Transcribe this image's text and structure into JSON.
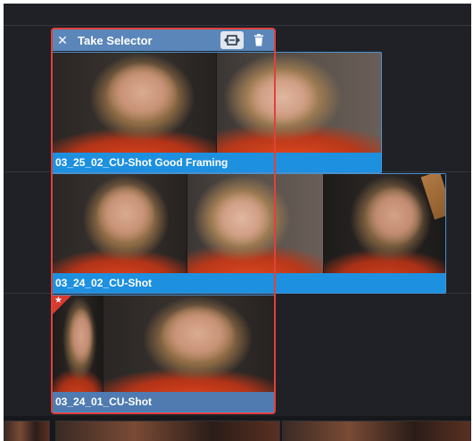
{
  "take_selector": {
    "title": "Take Selector",
    "close_icon": "close-icon",
    "fit_icon": "expand-horizontal-icon",
    "delete_icon": "trash-icon",
    "highlight_color": "#e0413b",
    "header_color": "#5b86b9"
  },
  "takes": [
    {
      "name": "03_25_02_CU-Shot Good Framing",
      "selected": false,
      "color": "#1e90e0"
    },
    {
      "name": "03_24_02_CU-Shot",
      "selected": false,
      "color": "#1e90e0"
    },
    {
      "name": "03_24_01_CU-Shot",
      "selected": true,
      "favorite": true,
      "color": "#4f7bb0"
    }
  ],
  "favorite_marker": "★"
}
